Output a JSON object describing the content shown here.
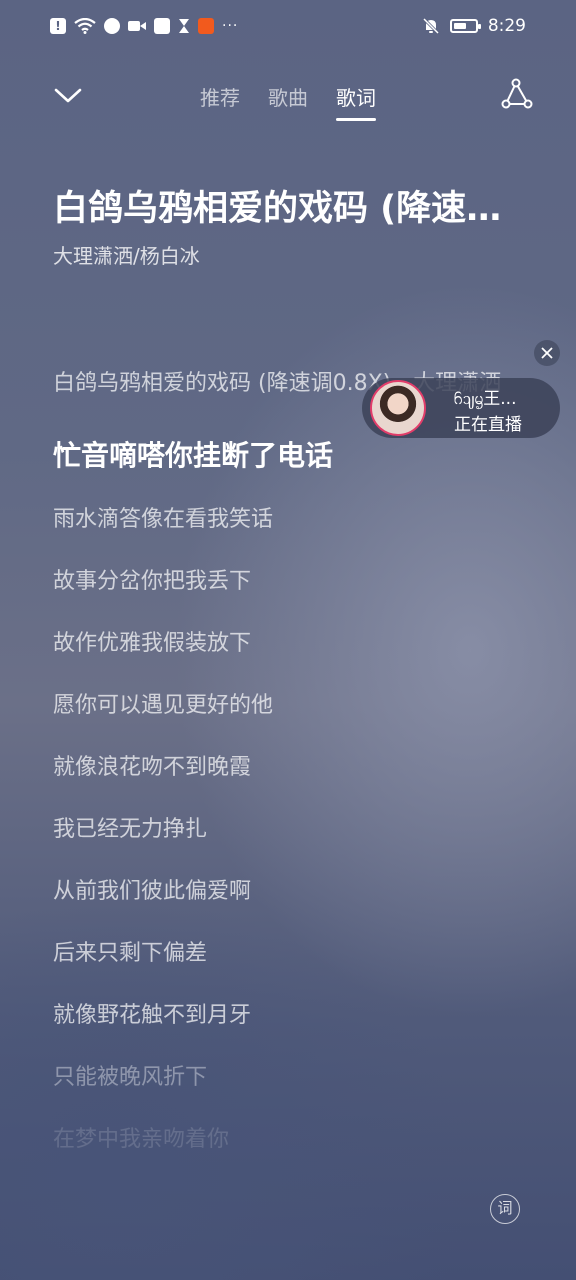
{
  "status_bar": {
    "time": "8:29",
    "more": "···",
    "icons": [
      "alert-icon",
      "wifi-icon",
      "music-app-icon",
      "video-icon",
      "bag-icon",
      "hourglass-icon",
      "orange-app-icon",
      "bell-off-icon",
      "battery-icon"
    ],
    "battery_level": 0.6
  },
  "nav": {
    "tabs": [
      "推荐",
      "歌曲",
      "歌词"
    ],
    "active_tab": "歌词"
  },
  "song": {
    "title": "白鸽乌鸦相爱的戏码 (降速调0.8X) - 大理潇洒",
    "artist": "大理潇洒/杨白冰"
  },
  "lyrics": {
    "title_line": "白鸽乌鸦相爱的戏码 (降速调0.8X) - 大理潇洒",
    "current": "忙音嘀嗒你挂断了电话",
    "lines": [
      "雨水滴答像在看我笑话",
      "故事分岔你把我丢下",
      "故作优雅我假装放下",
      "愿你可以遇见更好的他",
      "就像浪花吻不到晚霞",
      "我已经无力挣扎",
      "从前我们彼此偏爱啊",
      "后来只剩下偏差",
      "就像野花触不到月牙"
    ],
    "fading": [
      "只能被晚风折下",
      "在梦中我亲吻着你"
    ]
  },
  "live": {
    "name": "ᦆᦻᧄ王...",
    "status": "正在直播"
  },
  "lyric_button": "词",
  "colors": {
    "accent_live": "#e23d6a",
    "background_top": "#5b6483",
    "background_bottom": "#444f73"
  }
}
